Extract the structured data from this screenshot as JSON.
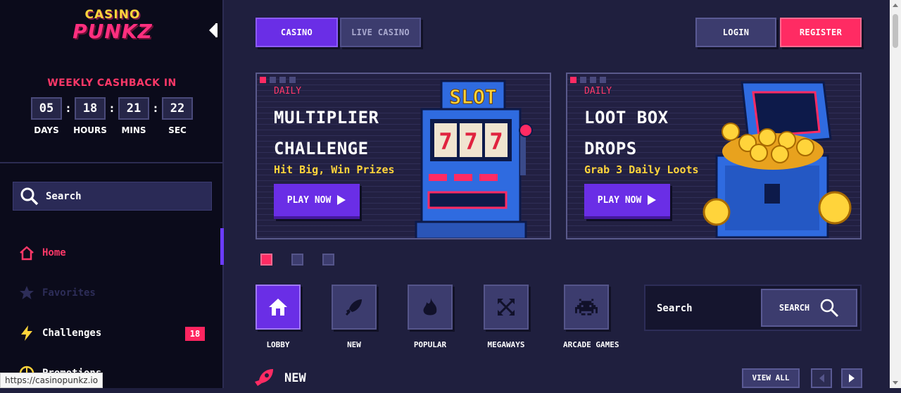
{
  "brand": {
    "line1": "CASINO",
    "line2": "PUNKZ"
  },
  "cashback": {
    "title": "WEEKLY CASHBACK IN",
    "timer": [
      {
        "value": "05",
        "label": "DAYS"
      },
      {
        "value": "18",
        "label": "HOURS"
      },
      {
        "value": "21",
        "label": "MINS"
      },
      {
        "value": "22",
        "label": "SEC"
      }
    ]
  },
  "sidebar": {
    "search_label": "Search",
    "nav": [
      {
        "label": "Home",
        "icon": "home-icon",
        "active": true
      },
      {
        "label": "Favorites",
        "icon": "star-icon",
        "muted": true
      },
      {
        "label": "Challenges",
        "icon": "lightning-icon",
        "badge": "18"
      },
      {
        "label": "Promotions",
        "icon": "globe-icon"
      }
    ]
  },
  "status_url": "https://casinopunkz.io",
  "header": {
    "tabs": [
      {
        "label": "CASINO",
        "active": true
      },
      {
        "label": "LIVE CASINO",
        "active": false
      }
    ],
    "login_label": "LOGIN",
    "register_label": "REGISTER"
  },
  "banners": [
    {
      "tag": "DAILY",
      "title_line1": "MULTIPLIER",
      "title_line2": "CHALLENGE",
      "subtitle": "Hit Big, Win Prizes",
      "cta": "PLAY NOW",
      "art": "slot-machine",
      "art_text": "SLOT",
      "reels": "777"
    },
    {
      "tag": "DAILY",
      "title_line1": "LOOT BOX",
      "title_line2": "DROPS",
      "subtitle": "Grab 3 Daily Loots",
      "cta": "PLAY NOW",
      "art": "treasure-chest"
    }
  ],
  "carousel": {
    "count": 3,
    "active_index": 0
  },
  "categories": [
    {
      "label": "LOBBY",
      "icon": "house-icon",
      "active": true
    },
    {
      "label": "NEW",
      "icon": "rocket-icon"
    },
    {
      "label": "POPULAR",
      "icon": "flame-icon"
    },
    {
      "label": "MEGAWAYS",
      "icon": "expand-arrows-icon"
    },
    {
      "label": "ARCADE GAMES",
      "icon": "space-invader-icon"
    }
  ],
  "game_search": {
    "placeholder": "Search",
    "button_label": "SEARCH"
  },
  "section_new": {
    "title": "NEW",
    "view_all": "VIEW ALL"
  },
  "colors": {
    "accent_purple": "#6a2ee6",
    "accent_pink": "#ff2b63",
    "gold": "#ffd43b",
    "bg": "#1f1f3e",
    "sidebar_bg": "#0b0b1b"
  }
}
